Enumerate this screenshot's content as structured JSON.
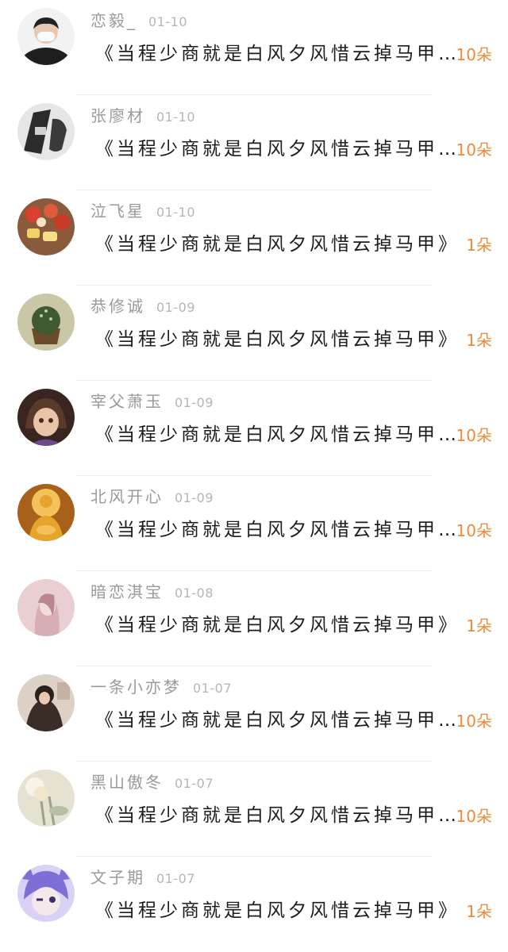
{
  "gift_list": [
    {
      "name": "恋毅_",
      "date": "01-10",
      "message": "《当程少商就是白风夕风惜云掉马甲…",
      "count": "10朵",
      "avatar_icon": "user-avatar-mask",
      "avatar_colors": [
        "#f2f2f2",
        "#1e1e1e"
      ]
    },
    {
      "name": "张廖材",
      "date": "01-10",
      "message": "《当程少商就是白风夕风惜云掉马甲…",
      "count": "10朵",
      "avatar_icon": "user-avatar-phone",
      "avatar_colors": [
        "#e6e6e6",
        "#2b2b2b"
      ]
    },
    {
      "name": "泣飞星",
      "date": "01-10",
      "message": "《当程少商就是白风夕风惜云掉马甲》",
      "count": "1朵",
      "avatar_icon": "user-avatar-food",
      "avatar_colors": [
        "#d8402f",
        "#f1d26a"
      ]
    },
    {
      "name": "恭修诚",
      "date": "01-09",
      "message": "《当程少商就是白风夕风惜云掉马甲》",
      "count": "1朵",
      "avatar_icon": "user-avatar-cupcake",
      "avatar_colors": [
        "#c9c7a6",
        "#3f5a2e"
      ]
    },
    {
      "name": "宰父萧玉",
      "date": "01-09",
      "message": "《当程少商就是白风夕风惜云掉马甲…",
      "count": "10朵",
      "avatar_icon": "user-avatar-anime",
      "avatar_colors": [
        "#5a3a2a",
        "#e9c4a8"
      ]
    },
    {
      "name": "北风开心",
      "date": "01-09",
      "message": "《当程少商就是白风夕风惜云掉马甲…",
      "count": "10朵",
      "avatar_icon": "user-avatar-buddha",
      "avatar_colors": [
        "#e6a42c",
        "#a8611a"
      ]
    },
    {
      "name": "暗恋淇宝",
      "date": "01-08",
      "message": "《当程少商就是白风夕风惜云掉马甲》",
      "count": "1朵",
      "avatar_icon": "user-avatar-portrait",
      "avatar_colors": [
        "#e9cfd2",
        "#b9878f"
      ]
    },
    {
      "name": "一条小亦梦",
      "date": "01-07",
      "message": "《当程少商就是白风夕风惜云掉马甲…",
      "count": "10朵",
      "avatar_icon": "user-avatar-photo",
      "avatar_colors": [
        "#ddd0c4",
        "#3a2d27"
      ]
    },
    {
      "name": "黑山傲冬",
      "date": "01-07",
      "message": "《当程少商就是白风夕风惜云掉马甲…",
      "count": "10朵",
      "avatar_icon": "user-avatar-flowers",
      "avatar_colors": [
        "#e5e1d3",
        "#9aa38a"
      ]
    },
    {
      "name": "文子期",
      "date": "01-07",
      "message": "《当程少商就是白风夕风惜云掉马甲》",
      "count": "1朵",
      "avatar_icon": "user-avatar-cartoon",
      "avatar_colors": [
        "#7d6fd6",
        "#d9d2f6"
      ]
    }
  ]
}
